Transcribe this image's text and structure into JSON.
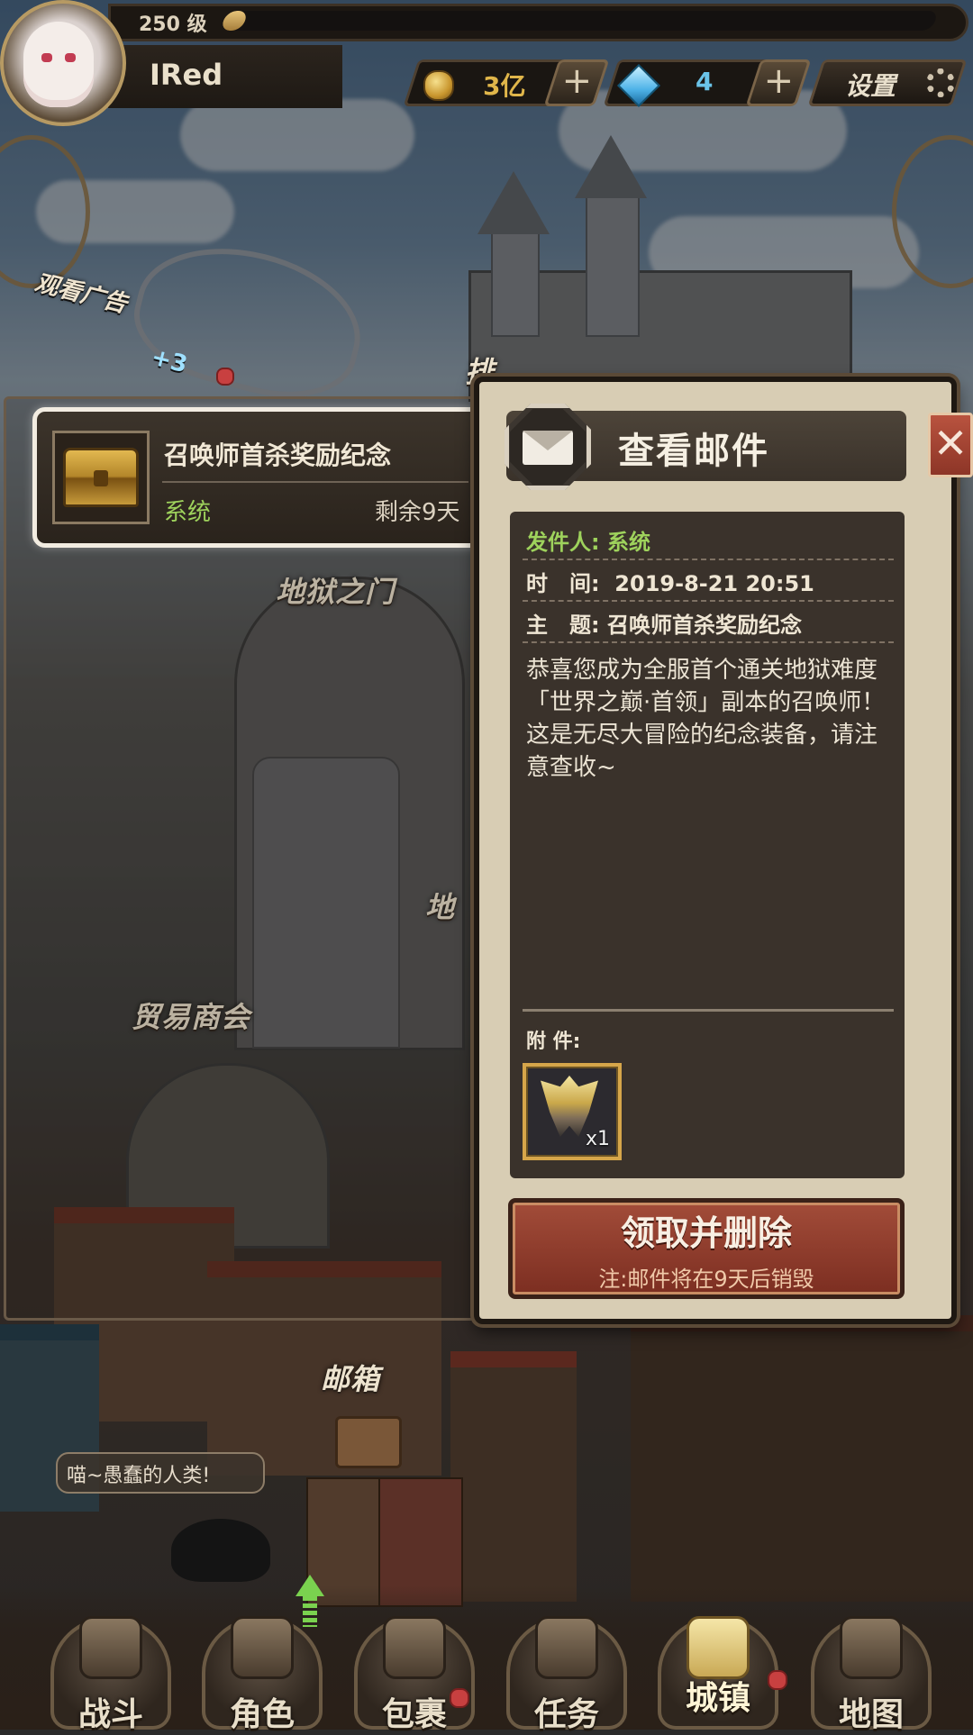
{
  "hud": {
    "level": "250 级",
    "xp_fraction": 0.03,
    "player_name": "IRed",
    "gold": "3亿",
    "gems": "4",
    "plus_symbol": "+",
    "settings_label": "设置"
  },
  "ad": {
    "label": "观看广告",
    "reward": "+3"
  },
  "places": {
    "hell_gate": "地狱之门",
    "leaderboard_partial": "排",
    "dungeon_partial": "地",
    "trade_guild": "贸易商会",
    "mailbox": "邮箱"
  },
  "mail_list": {
    "items": [
      {
        "title": "召唤师首杀奖励纪念",
        "sender": "系统",
        "remaining": "剩余9天"
      }
    ]
  },
  "mail_detail": {
    "title": "查看邮件",
    "close_symbol": "✕",
    "sender_line": "发件人: 系统",
    "time_line": "时　间:  2019-8-21 20:51",
    "subject_line": "主　题: 召唤师首杀奖励纪念",
    "body": "恭喜您成为全服首个通关地狱难度「世界之巅·首领」副本的召唤师！\n这是无尽大冒险的纪念装备，请注意查收~",
    "attachments_label": "附 件:",
    "attachment_qty": "x1",
    "claim_label": "领取并删除",
    "claim_note": "注:邮件将在9天后销毁"
  },
  "speech": "喵~愚蠢的人类!",
  "nav": {
    "items": [
      {
        "label": "战斗",
        "icon": "sword-shield-icon"
      },
      {
        "label": "角色",
        "icon": "helmet-icon"
      },
      {
        "label": "包裹",
        "icon": "backpack-icon"
      },
      {
        "label": "任务",
        "icon": "scroll-icon"
      },
      {
        "label": "城镇",
        "icon": "castle-icon"
      },
      {
        "label": "地图",
        "icon": "map-icon"
      }
    ]
  },
  "colors": {
    "sender_green": "#9ed25c",
    "gem_blue": "#4fb3e8",
    "gold": "#e0b64a",
    "claim_red": "#8f3a2a",
    "notification_red": "#c84040"
  }
}
